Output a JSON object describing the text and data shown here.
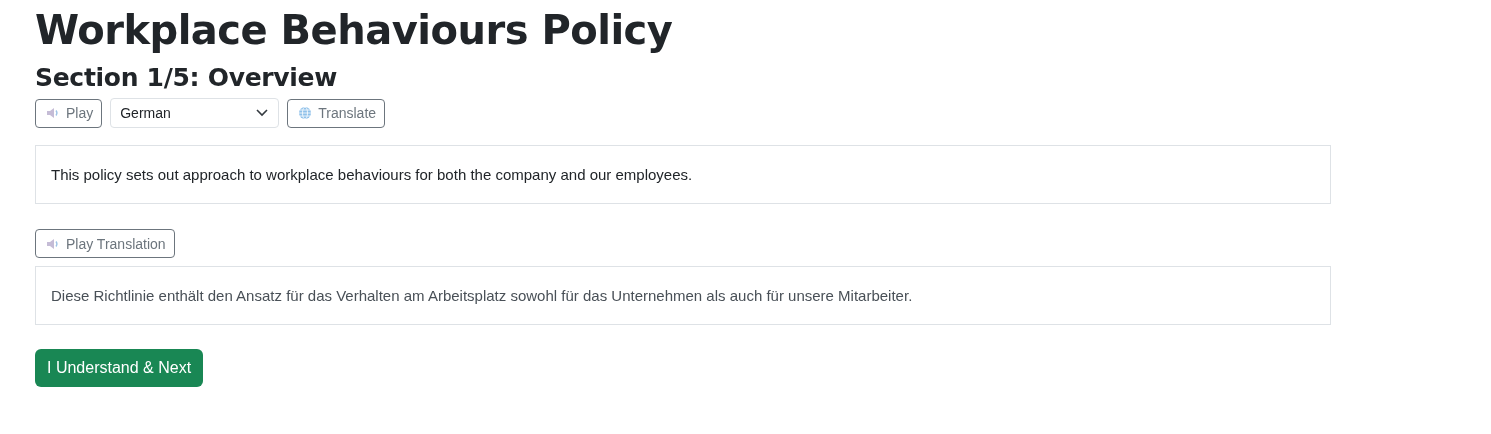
{
  "title": "Workplace Behaviours Policy",
  "section_heading": "Section 1/5: Overview",
  "play_button": {
    "label": "Play"
  },
  "language_select": {
    "value": "German"
  },
  "translate_button": {
    "label": "Translate"
  },
  "original_text": "This policy sets out approach to workplace behaviours for both the company and our employees.",
  "play_translation_button": {
    "label": "Play Translation"
  },
  "translated_text": "Diese Richtlinie enthält den Ansatz für das Verhalten am Arbeitsplatz sowohl für das Unternehmen als auch für unsere Mitarbeiter.",
  "next_button": {
    "label": "I Understand & Next"
  }
}
